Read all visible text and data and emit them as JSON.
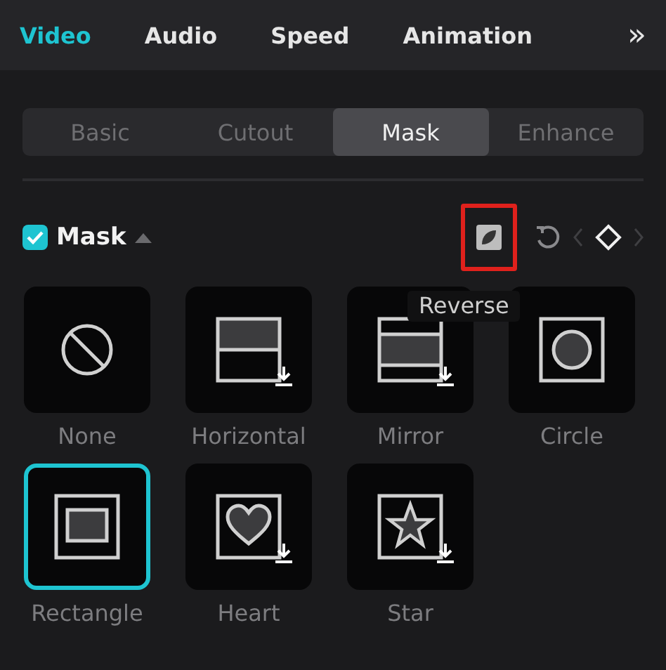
{
  "top_tabs": [
    {
      "label": "Video",
      "selected": true
    },
    {
      "label": "Audio",
      "selected": false
    },
    {
      "label": "Speed",
      "selected": false
    },
    {
      "label": "Animation",
      "selected": false
    }
  ],
  "more_tabs": "»",
  "sub_tabs": [
    {
      "label": "Basic",
      "selected": false
    },
    {
      "label": "Cutout",
      "selected": false
    },
    {
      "label": "Mask",
      "selected": true
    },
    {
      "label": "Enhance",
      "selected": false
    }
  ],
  "mask": {
    "label": "Mask",
    "checked": true,
    "expanded": true
  },
  "tooltip": "Reverse",
  "masks": [
    {
      "kind": "none",
      "label": "None",
      "selected": false,
      "download": false
    },
    {
      "kind": "horizontal",
      "label": "Horizontal",
      "selected": false,
      "download": true
    },
    {
      "kind": "mirror",
      "label": "Mirror",
      "selected": false,
      "download": true
    },
    {
      "kind": "circle",
      "label": "Circle",
      "selected": false,
      "download": false
    },
    {
      "kind": "rectangle",
      "label": "Rectangle",
      "selected": true,
      "download": false
    },
    {
      "kind": "heart",
      "label": "Heart",
      "selected": false,
      "download": true
    },
    {
      "kind": "star",
      "label": "Star",
      "selected": false,
      "download": true
    }
  ]
}
